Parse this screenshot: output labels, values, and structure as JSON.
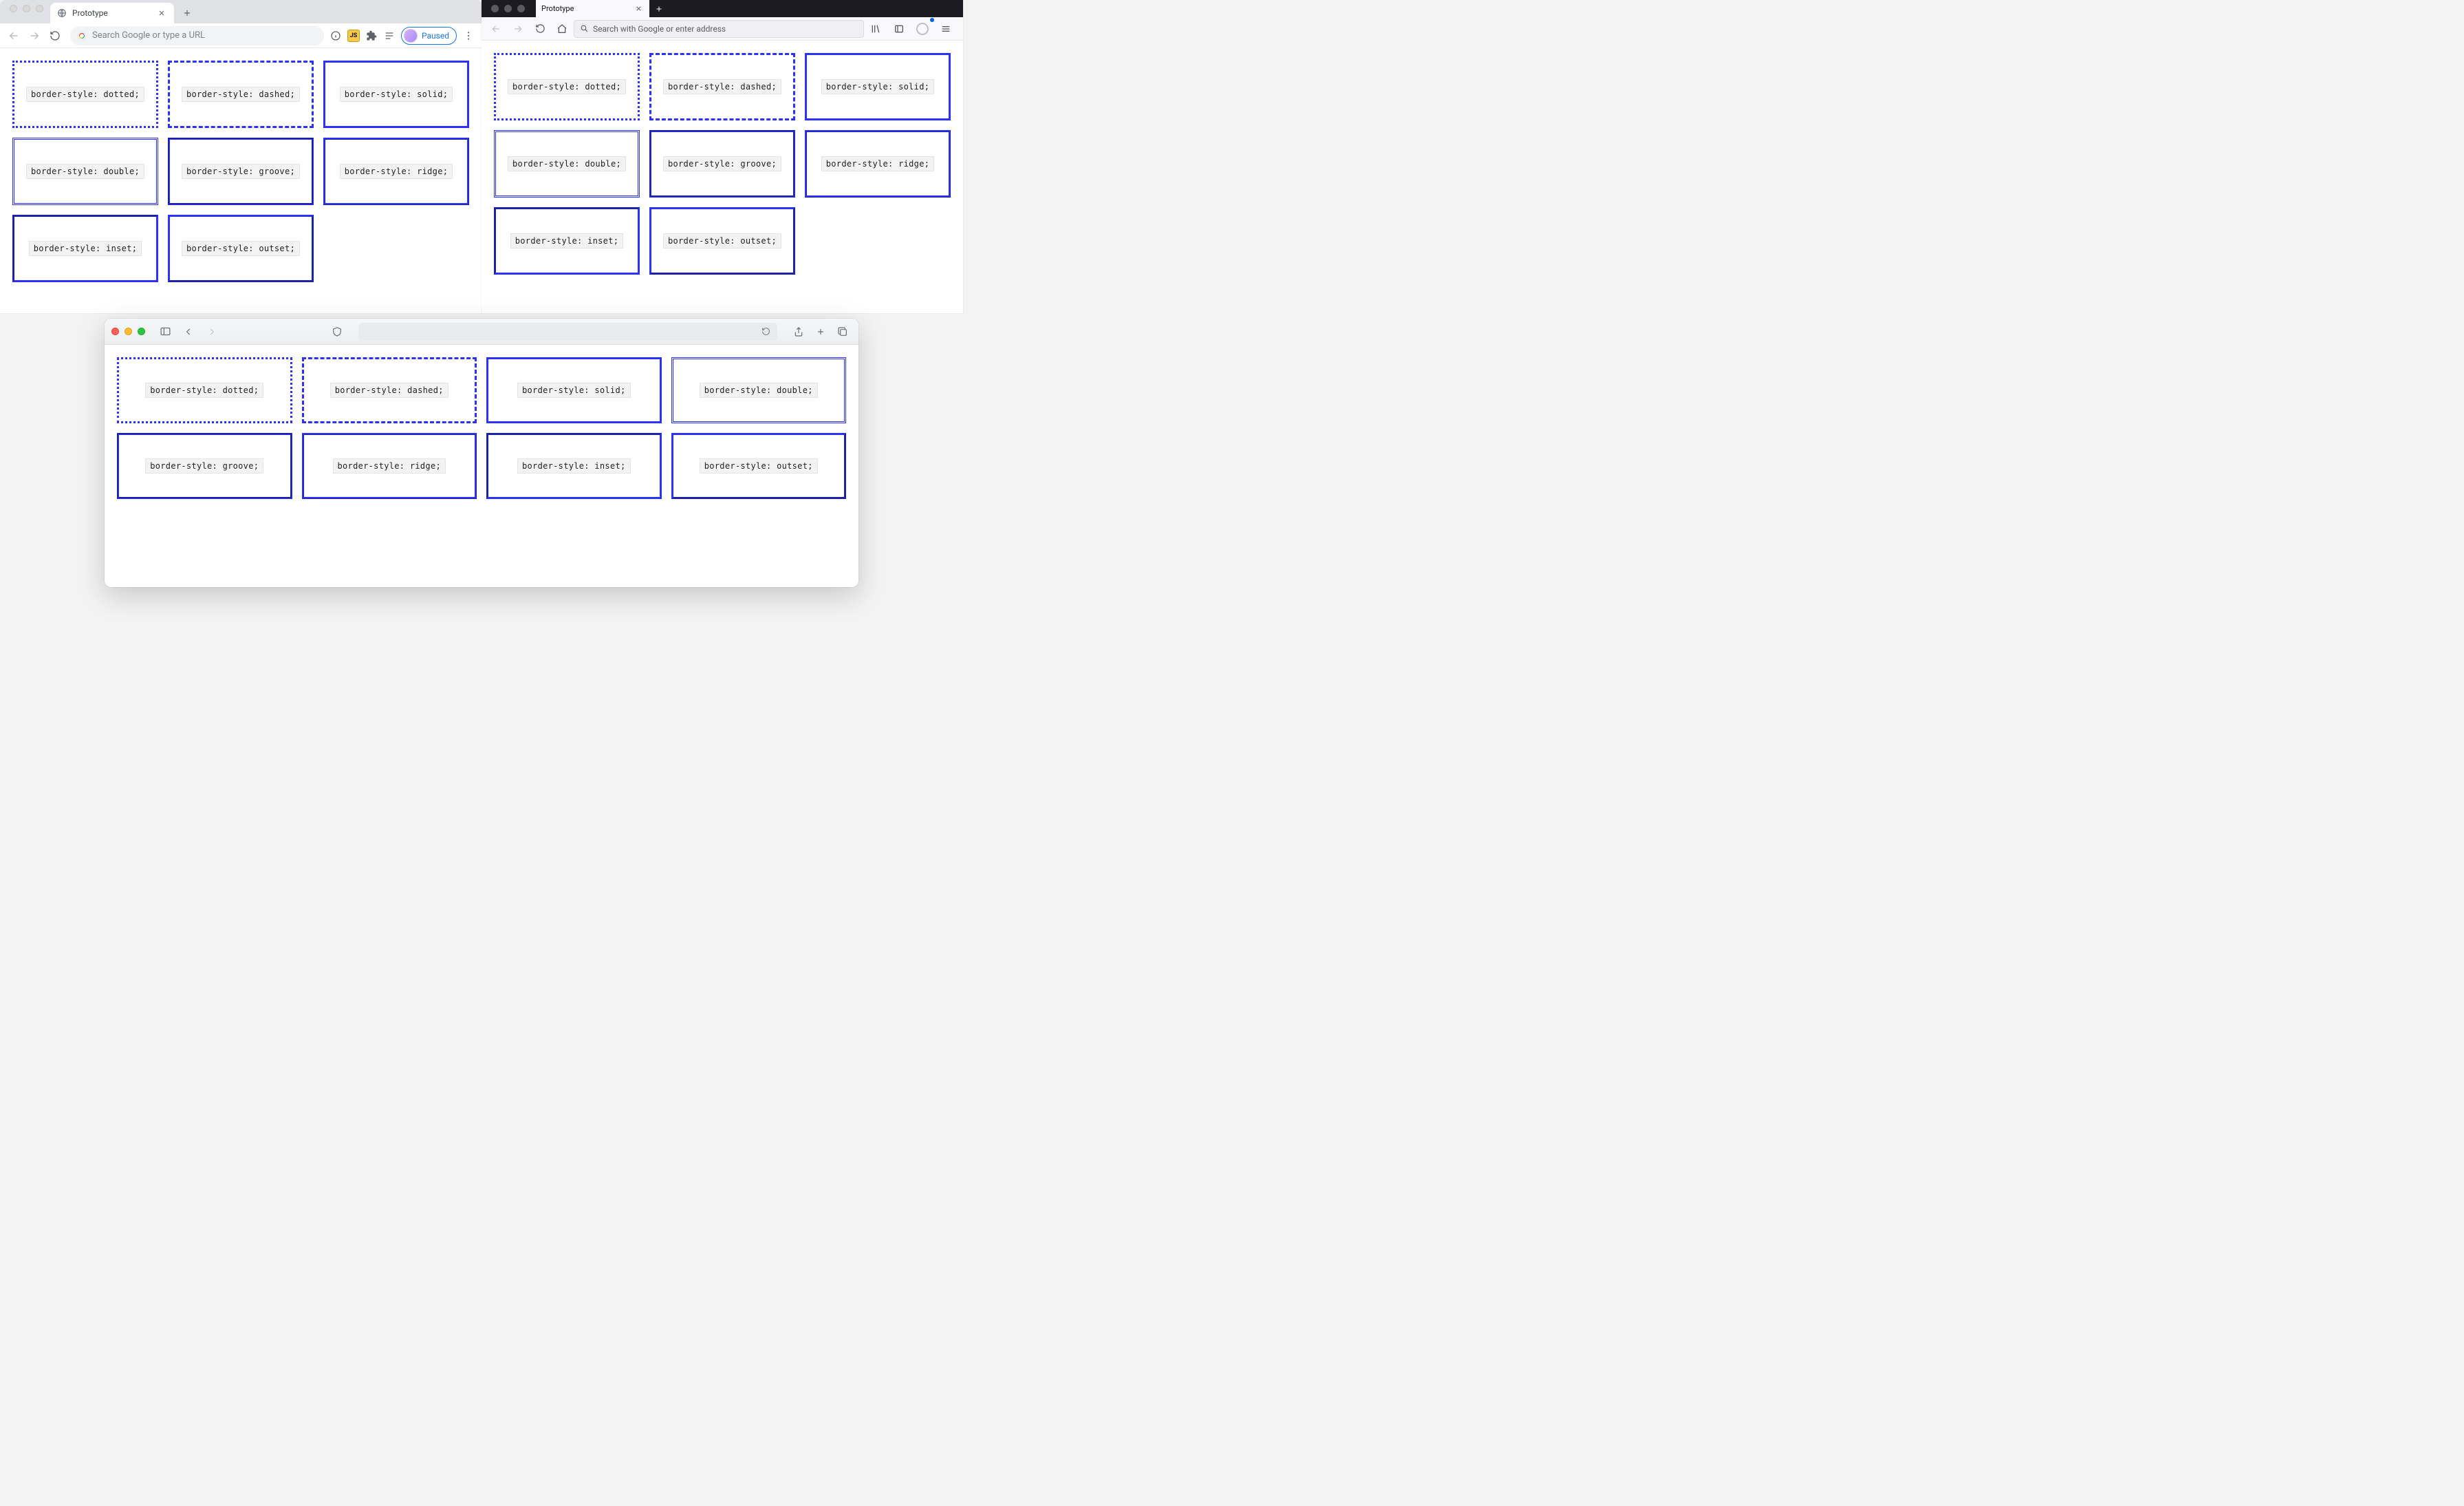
{
  "chrome": {
    "tab_title": "Prototype",
    "omnibox_placeholder": "Search Google or type a URL",
    "paused_label": "Paused",
    "boxes": [
      {
        "style": "dotted",
        "label": "border-style: dotted;"
      },
      {
        "style": "dashed",
        "label": "border-style: dashed;"
      },
      {
        "style": "solid",
        "label": "border-style: solid;"
      },
      {
        "style": "double",
        "label": "border-style: double;"
      },
      {
        "style": "groove",
        "label": "border-style: groove;"
      },
      {
        "style": "ridge",
        "label": "border-style: ridge;"
      },
      {
        "style": "inset",
        "label": "border-style: inset;"
      },
      {
        "style": "outset",
        "label": "border-style: outset;"
      }
    ]
  },
  "firefox": {
    "tab_title": "Prototype",
    "urlbar_placeholder": "Search with Google or enter address",
    "boxes": [
      {
        "style": "dotted",
        "label": "border-style: dotted;"
      },
      {
        "style": "dashed",
        "label": "border-style: dashed;"
      },
      {
        "style": "solid",
        "label": "border-style: solid;"
      },
      {
        "style": "double",
        "label": "border-style: double;"
      },
      {
        "style": "groove",
        "label": "border-style: groove;"
      },
      {
        "style": "ridge",
        "label": "border-style: ridge;"
      },
      {
        "style": "inset",
        "label": "border-style: inset;"
      },
      {
        "style": "outset",
        "label": "border-style: outset;"
      }
    ]
  },
  "safari": {
    "boxes": [
      {
        "style": "dotted",
        "label": "border-style: dotted;"
      },
      {
        "style": "dashed",
        "label": "border-style: dashed;"
      },
      {
        "style": "solid",
        "label": "border-style: solid;"
      },
      {
        "style": "double",
        "label": "border-style: double;"
      },
      {
        "style": "groove",
        "label": "border-style: groove;"
      },
      {
        "style": "ridge",
        "label": "border-style: ridge;"
      },
      {
        "style": "inset",
        "label": "border-style: inset;"
      },
      {
        "style": "outset",
        "label": "border-style: outset;"
      }
    ]
  },
  "colors": {
    "border": "#2b32ff"
  }
}
